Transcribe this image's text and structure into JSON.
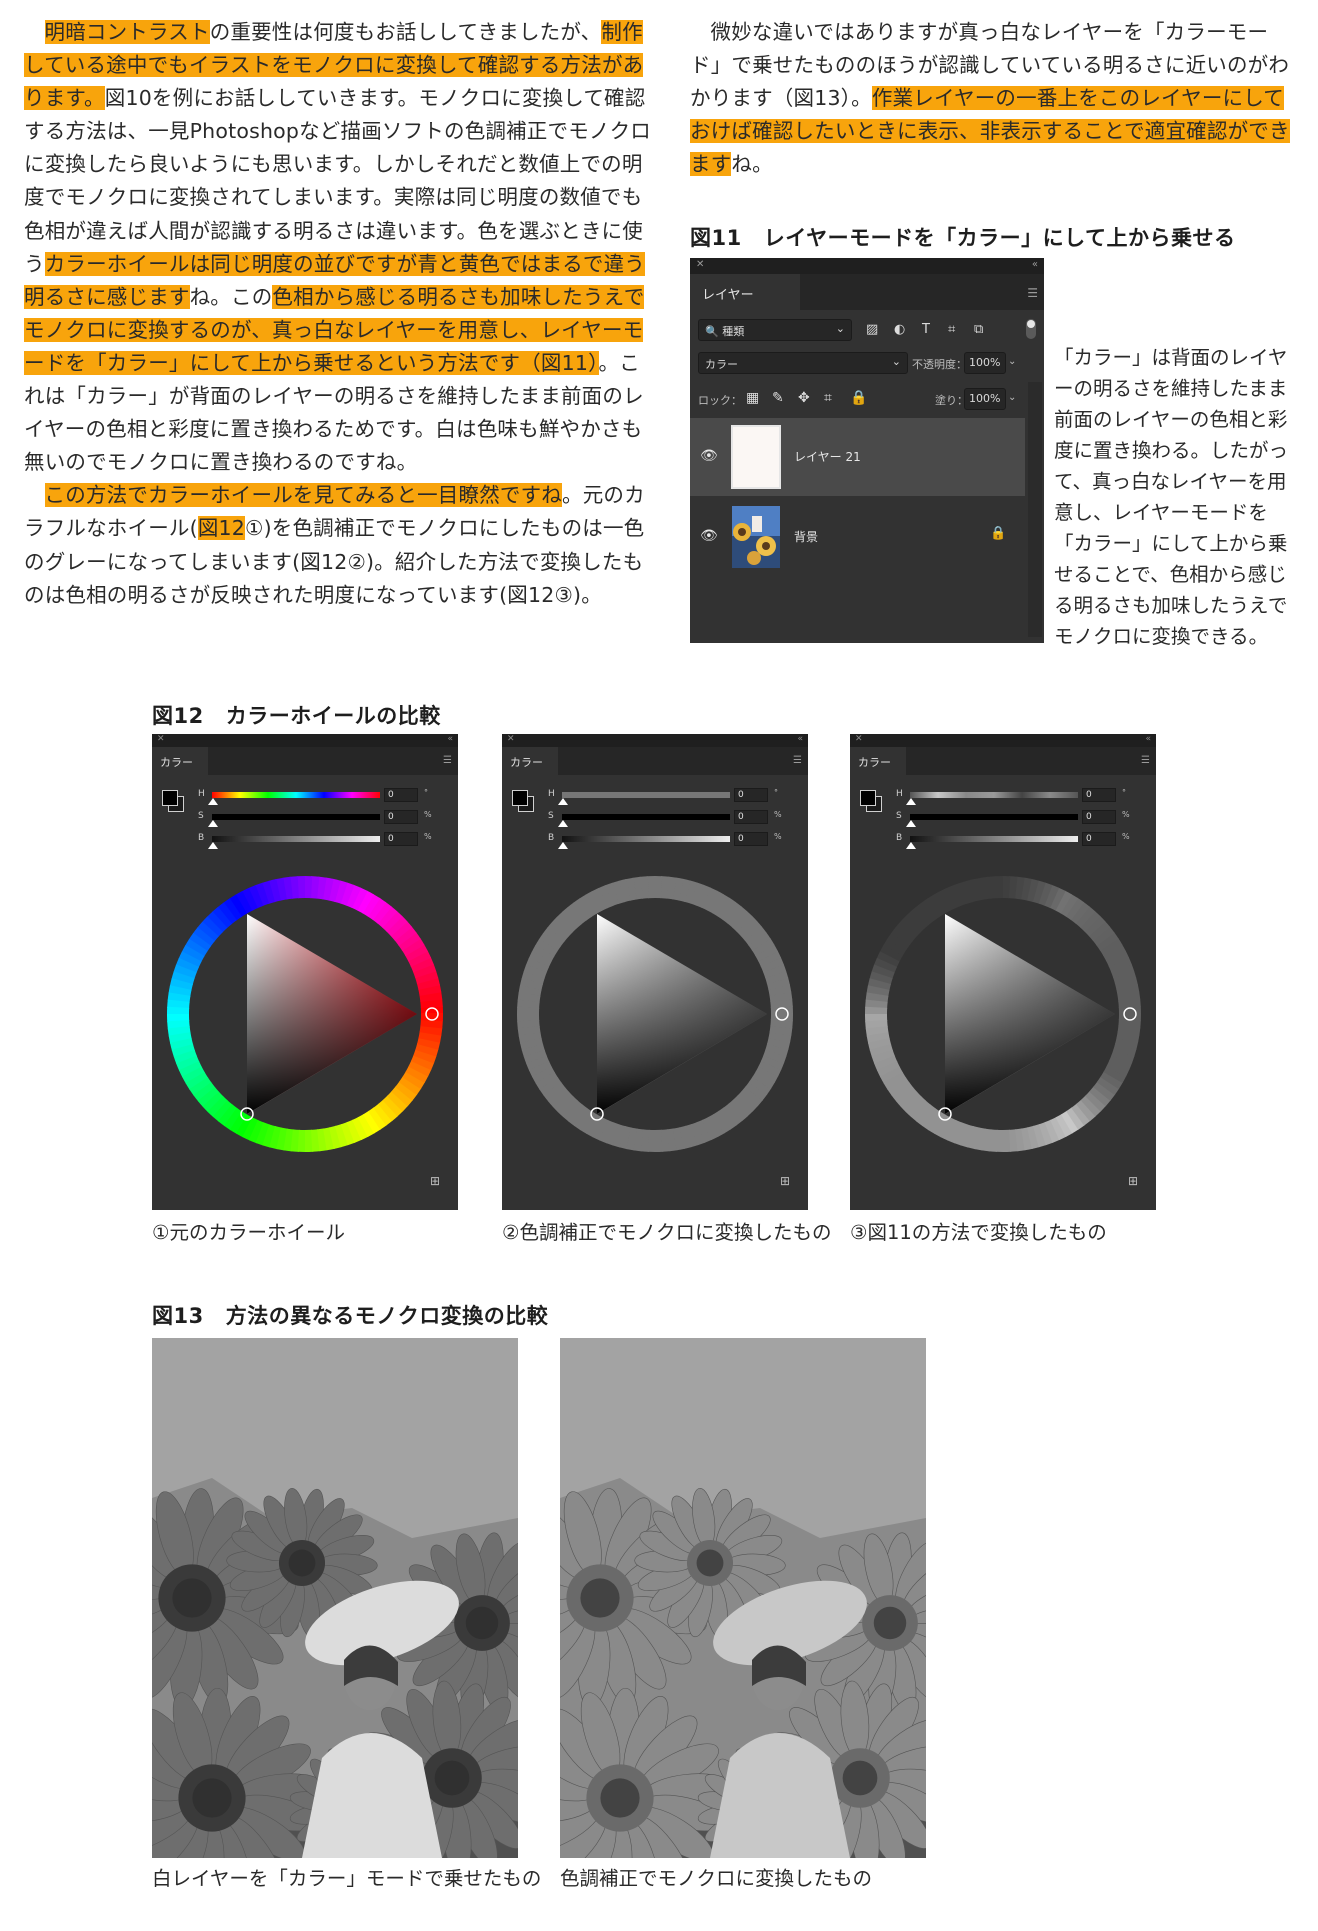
{
  "left_column": {
    "p1": {
      "a": "明暗コントラスト",
      "b": "の重要性は何度もお話ししてきましたが、",
      "c": "制作している途中でもイラストをモノクロに変換して確認する方法があります。",
      "d": "図10を例にお話ししていきます。モノクロに変換して確認する方法は、一見Photoshopなど描画ソフトの色調補正でモノクロに変換したら良いようにも思います。しかしそれだと数値上での明度でモノクロに変換されてしまいます。実際は同じ明度の数値でも色相が違えば人間が認識する明るさは違います。色を選ぶときに使う",
      "e": "カラーホイールは同じ明度の並びですが青と黄色ではまるで違う明るさに感じます",
      "f": "ね。この",
      "g": "色相から感じる明るさも加味したうえでモノクロに変換するのが、",
      "h": "真っ白なレイヤーを用意し、レイヤーモードを「カラー」にして上から乗せるという方法です（図11）",
      "i": "。これは「カラー」が背面のレイヤーの明るさを維持したまま前面のレイヤーの色相と彩度に置き換わるためです。白は色味も鮮やかさも無いのでモノクロに置き換わるのですね。"
    },
    "p2": {
      "a": "この方法でカラーホイールを見てみると一目瞭然ですね",
      "b": "。元のカラフルなホイール(",
      "c": "図12",
      "d": "①)を色調補正でモノクロにしたものは一色のグレーになってしまいます(図12②)。紹介した方法で変換したものは色相の明るさが反映された明度になっています(図12③)。"
    }
  },
  "right_column": {
    "p1": {
      "a": "微妙な違いではありますが真っ白なレイヤーを「カラーモード」で乗せたもののほうが認識していている明るさに近いのがわかります（図13）。",
      "b": "作業レイヤーの一番上をこのレイヤーにしておけば確認したいときに表示、非表示することで適宜確認ができます",
      "c": "ね。"
    }
  },
  "fig11": {
    "num": "図11",
    "title": "レイヤーモードを「カラー」にして上から乗せる",
    "caption": "「カラー」は背面のレイヤーの明るさを維持したまま前面のレイヤーの色相と彩度に置き換わる。したがって、真っ白なレイヤーを用意し、レイヤーモードを「カラー」にして上から乗せることで、色相から感じる明るさも加味したうえでモノクロに変換できる。",
    "panel": {
      "tab": "レイヤー",
      "kind": "種類",
      "blend_mode": "カラー",
      "opacity_label": "不透明度：",
      "opacity": "100%",
      "lock_label": "ロック：",
      "fill_label": "塗り：",
      "fill": "100%",
      "layers": [
        {
          "name": "レイヤー 21"
        },
        {
          "name": "背景"
        }
      ]
    }
  },
  "fig12": {
    "num": "図12",
    "title": "カラーホイールの比較",
    "panels": [
      {
        "tab": "カラー",
        "h": "0",
        "s": "0",
        "b": "0",
        "caption": "①元のカラーホイール"
      },
      {
        "tab": "カラー",
        "h": "0",
        "s": "0",
        "b": "0",
        "caption": "②色調補正でモノクロに変換したもの"
      },
      {
        "tab": "カラー",
        "h": "0",
        "s": "0",
        "b": "0",
        "caption": "③図11の方法で変換したもの"
      }
    ],
    "labels": {
      "h": "H",
      "s": "S",
      "b": "B",
      "deg": "°",
      "pct": "%"
    }
  },
  "fig13": {
    "num": "図13",
    "title": "方法の異なるモノクロ変換の比較",
    "captions": [
      "白レイヤーを「カラー」モードで乗せたもの",
      "色調補正でモノクロに変換したもの"
    ]
  },
  "colors": {
    "highlight": "#f8a40c",
    "panel_bg": "#323232",
    "panel_dark": "#262626"
  }
}
